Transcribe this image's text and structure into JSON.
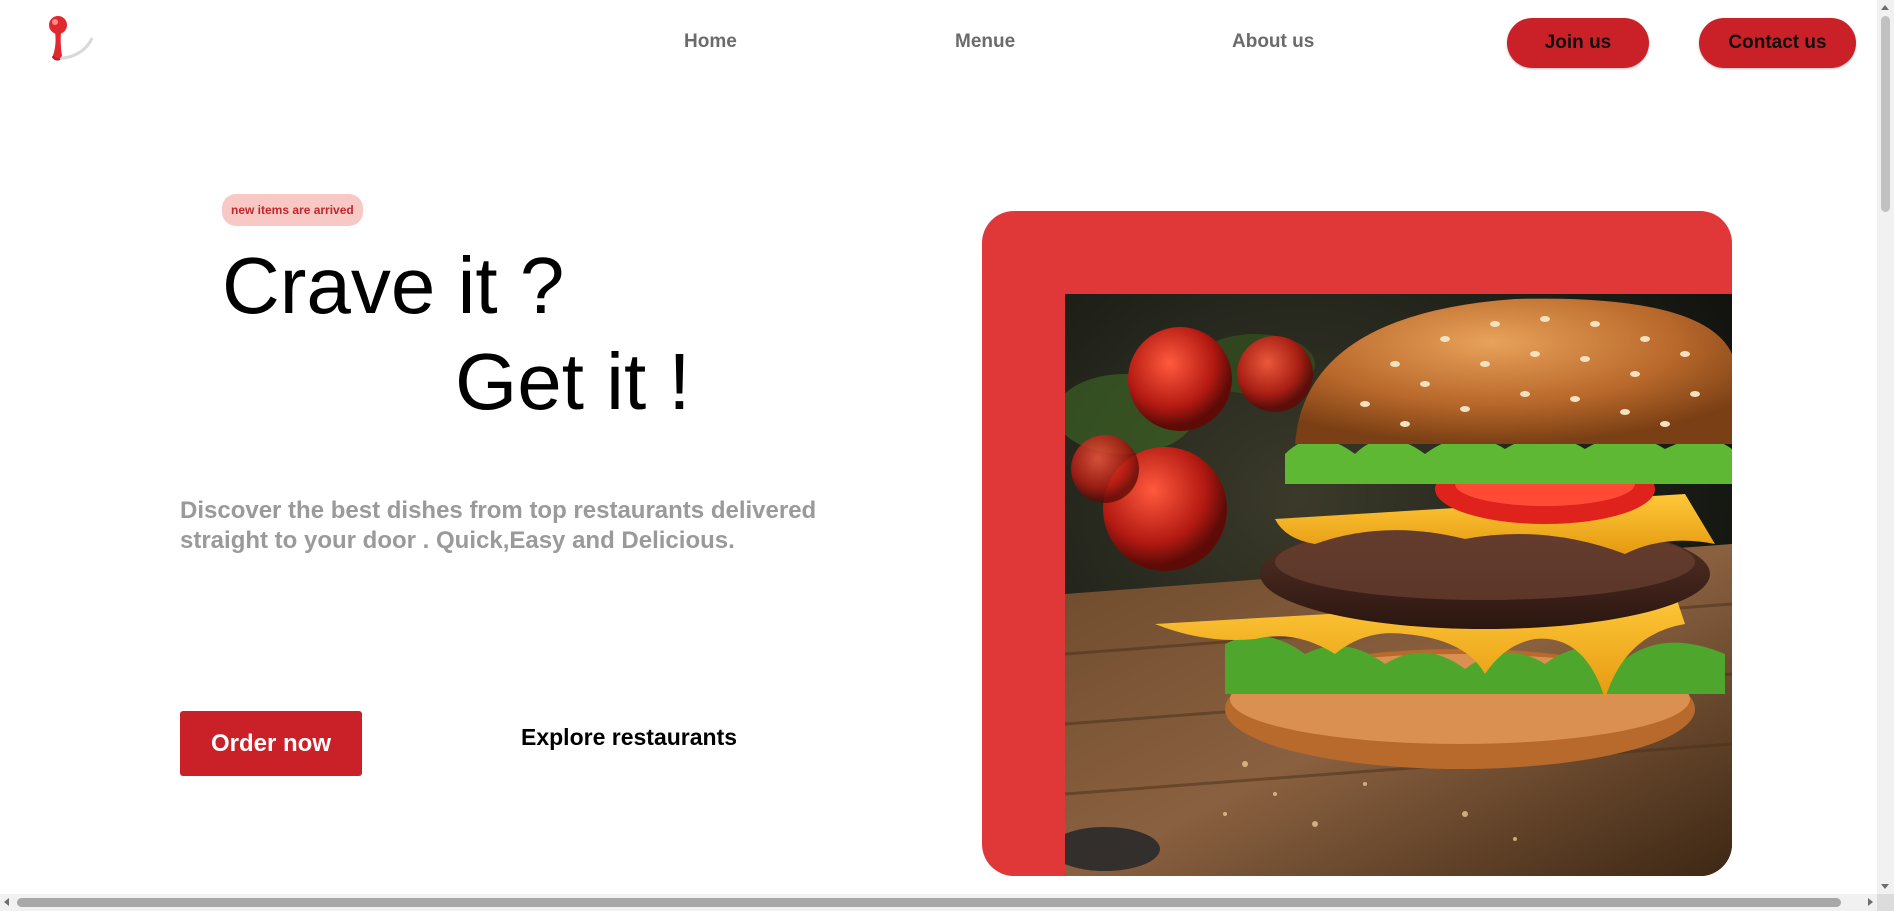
{
  "nav": {
    "links": [
      "Home",
      "Menue",
      "About us"
    ],
    "join_label": "Join us",
    "contact_label": "Contact us"
  },
  "hero": {
    "badge": "new items are arrived",
    "headline_line1": "Crave it ?",
    "headline_line2": "Get it !",
    "description": "Discover the best dishes from top restaurants delivered straight to your door . Quick,Easy and Delicious.",
    "order_label": "Order now",
    "explore_label": "Explore restaurants"
  },
  "colors": {
    "accent": "#c92127",
    "frame": "#e03738",
    "badge_bg": "#f8c9c4",
    "badge_text": "#c0272d",
    "nav_text": "#6b6b6b",
    "muted_text": "#9a9a9a"
  },
  "icons": {
    "logo": "red-pin-logo-icon"
  }
}
